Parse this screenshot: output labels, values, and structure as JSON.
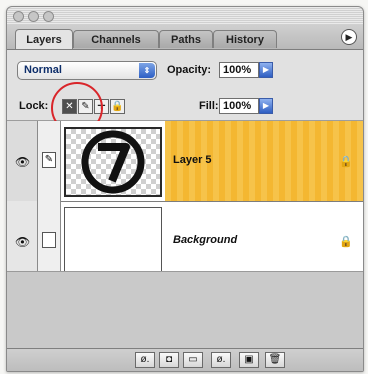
{
  "window": {
    "tabs": [
      "Layers",
      "Channels",
      "Paths",
      "History"
    ]
  },
  "controls": {
    "blend_mode": "Normal",
    "opacity_label": "Opacity:",
    "opacity_value": "100%",
    "lock_label": "Lock:",
    "fill_label": "Fill:",
    "fill_value": "100%"
  },
  "layers": [
    {
      "name": "Layer 5"
    },
    {
      "name": "Background"
    }
  ],
  "icons": {
    "eye": "👁",
    "brush": "✎",
    "move": "✛",
    "lock": "🔒",
    "menu": "▶",
    "arrow_right": "▶",
    "updown": "⇕",
    "footer": [
      "ø.",
      "◘",
      "▭",
      "ø.",
      "▣",
      "🗑"
    ]
  },
  "colors": {
    "selected_row": "#f4b731",
    "highlight_circle": "#d9252a",
    "tab_accent": "#2d5fc4"
  }
}
